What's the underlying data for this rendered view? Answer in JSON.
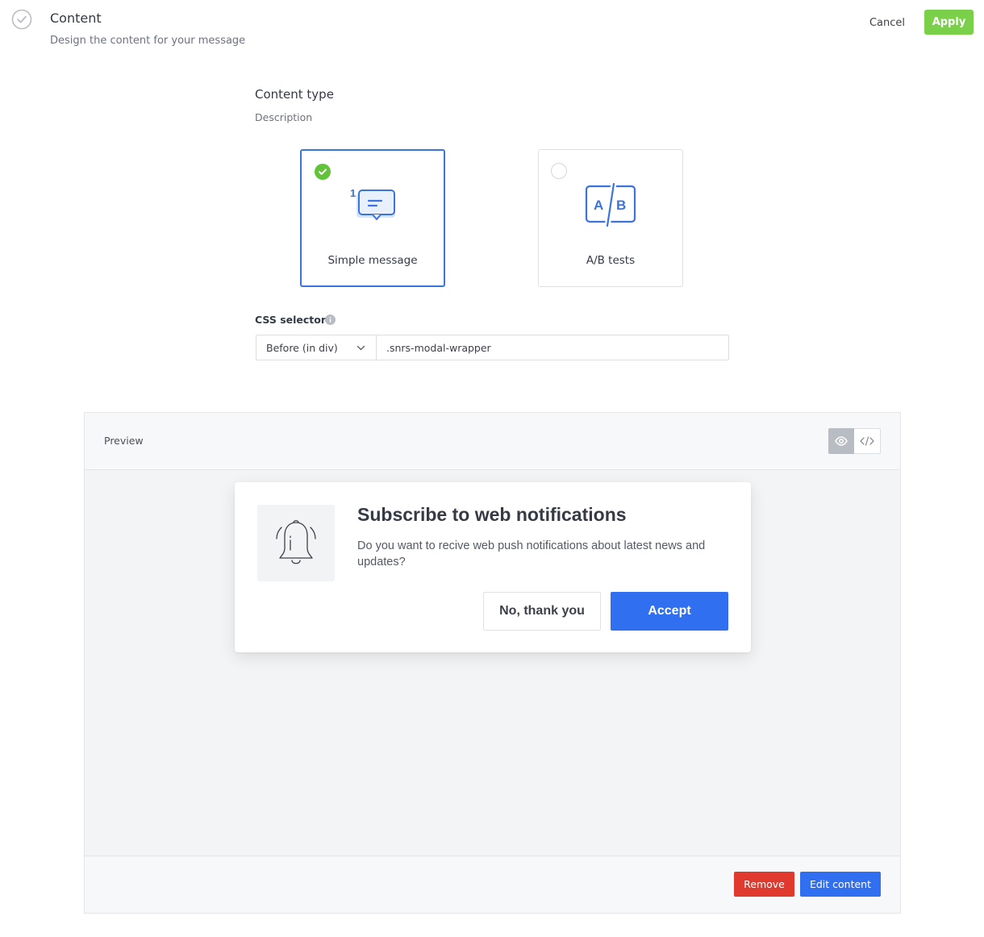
{
  "header": {
    "title": "Content",
    "subtitle": "Design the content for your message",
    "cancel_label": "Cancel",
    "apply_label": "Apply"
  },
  "content_type": {
    "title": "Content type",
    "description": "Description",
    "options": [
      {
        "label": "Simple message",
        "selected": true,
        "icon": "chat-bubble-icon",
        "badge": "1"
      },
      {
        "label": "A/B tests",
        "selected": false,
        "icon": "ab-test-icon",
        "icon_text": "A/B"
      }
    ]
  },
  "css_selector": {
    "label": "CSS selector",
    "position_value": "Before (in div)",
    "selector_value": ".snrs-modal-wrapper"
  },
  "preview": {
    "label": "Preview",
    "view_modes": [
      "preview-eye-icon",
      "code-icon"
    ],
    "active_view": "preview",
    "modal": {
      "title": "Subscribe to web notifications",
      "text": "Do you want to recive web push notifications about latest news and updates?",
      "decline_label": "No, thank you",
      "accept_label": "Accept"
    },
    "remove_label": "Remove",
    "edit_label": "Edit content"
  },
  "colors": {
    "apply_green": "#7bd049",
    "selected_border": "#3b73e0",
    "check_green": "#62c23a",
    "accent_blue": "#2f6ff0",
    "remove_red": "#e03a2f"
  }
}
